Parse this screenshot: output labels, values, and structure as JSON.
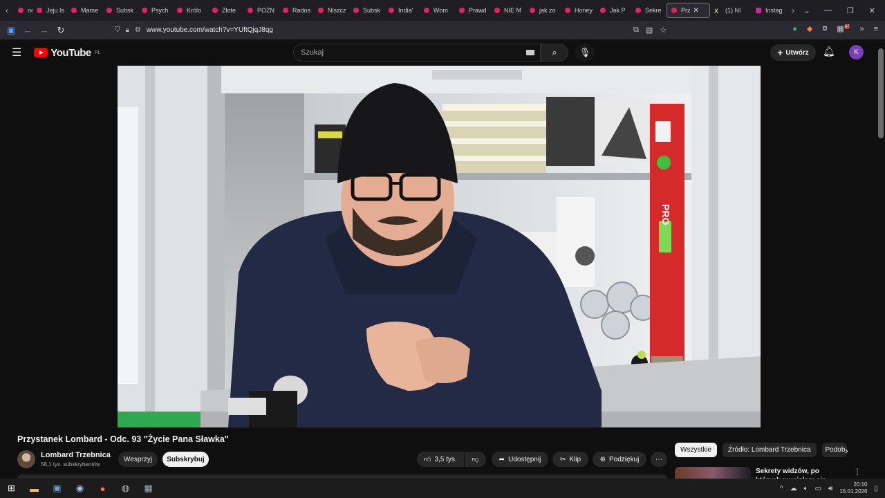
{
  "browser": {
    "tabs": [
      {
        "label": "ne"
      },
      {
        "label": "Jeju Is"
      },
      {
        "label": "Mame"
      },
      {
        "label": "Subsk"
      },
      {
        "label": "Psych"
      },
      {
        "label": "Królo"
      },
      {
        "label": "Złote"
      },
      {
        "label": "POZN"
      },
      {
        "label": "Rados"
      },
      {
        "label": "Niszcz"
      },
      {
        "label": "Subsk"
      },
      {
        "label": "India'"
      },
      {
        "label": "Wom"
      },
      {
        "label": "Prawd"
      },
      {
        "label": "NIE M"
      },
      {
        "label": "jak zo"
      },
      {
        "label": "Honey"
      },
      {
        "label": "Jak P"
      },
      {
        "label": "Sekre"
      },
      {
        "label": "Prz"
      },
      {
        "label": "(1) NI"
      },
      {
        "label": "Instag"
      }
    ],
    "url": "www.youtube.com/watch?v=YUftQjqJ8qg",
    "extension_badge": "97"
  },
  "youtube": {
    "logo_text": "YouTube",
    "region": "PL",
    "search_placeholder": "Szukaj",
    "create_label": "Utwórz",
    "avatar_letter": "K"
  },
  "video": {
    "title": "Przystanek Lombard - Odc. 93 \"Życie Pana Sławka\"",
    "channel_name": "Lombard Trzebnica",
    "subscribers": "58,1 tys. subskrybentów",
    "support_label": "Wesprzyj",
    "subscribe_label": "Subskrybuj",
    "likes": "3,5 tys.",
    "share_label": "Udostępnij",
    "clip_label": "Klip",
    "thanks_label": "Podziękuj",
    "level_label": "PRO"
  },
  "sidebar": {
    "chips": [
      "Wszystkie",
      "Źródło: Lombard Trzebnica",
      "Podob"
    ],
    "rec_title": "Sekrety widzów, po których musiałam się położyć..."
  },
  "taskbar": {
    "time": "20:10",
    "date": "15.01.2026"
  }
}
